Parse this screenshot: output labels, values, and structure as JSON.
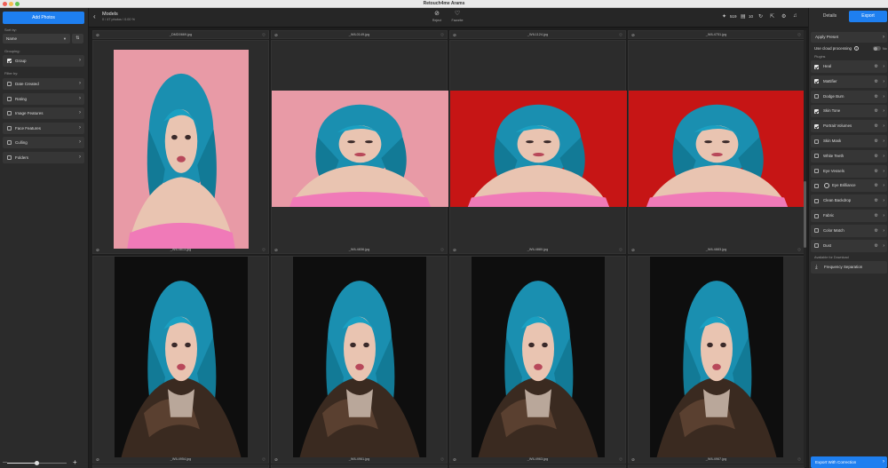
{
  "window": {
    "title": "Retouch4me Arams"
  },
  "left_panel": {
    "add_button": "Add Photos",
    "sort_label": "Sort by:",
    "sort_value": "Name",
    "grouping_label": "Grouping:",
    "group_label": "Group",
    "filter_label": "Filter by:",
    "filters": [
      "Date Created",
      "Rating",
      "Image Features",
      "Face Features",
      "Culling",
      "Folders"
    ],
    "zoom_level": 0.5
  },
  "toolbar": {
    "collection_name": "Models",
    "collection_info": "0 / 47 photos / 0.00 %",
    "reject_label": "Reject",
    "favorite_label": "Favorite",
    "retouched_count": "519",
    "presets_count": "10"
  },
  "grid": {
    "rows": [
      [
        "_DMD0669.jpg",
        "_WIL0149.jpg",
        "_WIL1124.jpg",
        "_WIL4751.jpg"
      ],
      [
        "_WIL4813.jpg",
        "_WIL4836.jpg",
        "_WIL4880.jpg",
        "_WIL4883.jpg"
      ],
      [
        "_WIL4954.jpg",
        "_WIL4961.jpg",
        "_WIL4963.jpg",
        "_WIL4967.jpg"
      ]
    ]
  },
  "right_panel": {
    "tabs": {
      "details": "Details",
      "export": "Export"
    },
    "apply_preset": "Apply Preset",
    "cloud_label": "Use cloud processing",
    "cloud_toggle_label": "No",
    "plugins_label": "Plugins",
    "plugins": [
      {
        "name": "Heal",
        "checked": true
      },
      {
        "name": "Mattifier",
        "checked": true
      },
      {
        "name": "Dodge Burn",
        "checked": false
      },
      {
        "name": "Skin Tone",
        "checked": true
      },
      {
        "name": "Portrait Volumes",
        "checked": true
      },
      {
        "name": "Skin Mask",
        "checked": false
      },
      {
        "name": "White Teeth",
        "checked": false
      },
      {
        "name": "Eye Vessels",
        "checked": false
      },
      {
        "name": "Eye Brilliance",
        "checked": false
      },
      {
        "name": "Clean Backdrop",
        "checked": false
      },
      {
        "name": "Fabric",
        "checked": false
      },
      {
        "name": "Color Match",
        "checked": false
      },
      {
        "name": "Dust",
        "checked": false
      }
    ],
    "available_label": "Available for Download",
    "download_item": "Frequency Separation",
    "export_button": "Export With Correction"
  },
  "colors": {
    "accent": "#1e7ff0",
    "hair": "#1a8fb0",
    "pink_bg": "#e89aa6",
    "red_bg": "#c61515",
    "dark_bg": "#0e0e0e"
  }
}
